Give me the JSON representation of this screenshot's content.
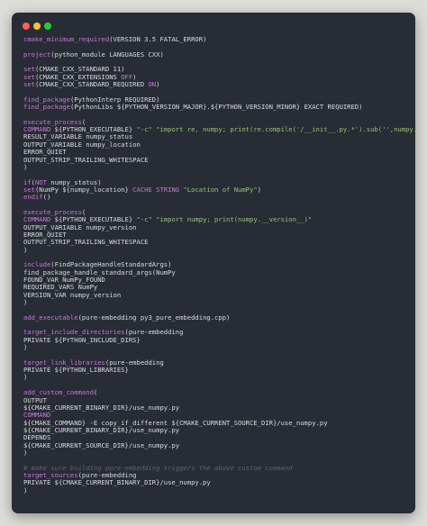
{
  "window": {
    "controls": [
      "close",
      "minimize",
      "maximize"
    ],
    "colors": {
      "close": "#ff5f56",
      "minimize": "#ffbd2e",
      "maximize": "#27c93f"
    }
  },
  "theme": {
    "background": "#282c34",
    "text": "#d8dbe0",
    "command": "#c678dd",
    "variable": "#e5c07b",
    "string": "#98c379",
    "comment": "#5c6370"
  },
  "code": {
    "lines": [
      [
        [
          "cmd",
          "cmake_minimum_required"
        ],
        [
          "t",
          "(VERSION 3.5 FATAL_ERROR)"
        ]
      ],
      [],
      [
        [
          "cmd",
          "project"
        ],
        [
          "t",
          "(python_module LANGUAGES CXX)"
        ]
      ],
      [],
      [
        [
          "cmd",
          "set"
        ],
        [
          "t",
          "(CMAKE_CXX_STANDARD 11)"
        ]
      ],
      [
        [
          "cmd",
          "set"
        ],
        [
          "t",
          "(CMAKE_CXX_EXTENSIONS "
        ],
        [
          "kw",
          "OFF"
        ],
        [
          "t",
          ")"
        ]
      ],
      [
        [
          "cmd",
          "set"
        ],
        [
          "t",
          "(CMAKE_CXX_STANDARD_REQUIRED "
        ],
        [
          "kw",
          "ON"
        ],
        [
          "t",
          ")"
        ]
      ],
      [],
      [
        [
          "cmd",
          "find_package"
        ],
        [
          "t",
          "(PythonInterp REQUIRED)"
        ]
      ],
      [
        [
          "cmd",
          "find_package"
        ],
        [
          "t",
          "(PythonLibs ${PYTHON_VERSION_MAJOR}.${PYTHON_VERSION_MINOR} EXACT REQUIRED)"
        ]
      ],
      [],
      [
        [
          "cmd",
          "execute_process"
        ],
        [
          "t",
          "("
        ]
      ],
      [
        [
          "kw",
          "COMMAND"
        ],
        [
          "t",
          " ${PYTHON_EXECUTABLE} "
        ],
        [
          "str",
          "\"-c\" \"import re, numpy; print(re.compile('/__init__.py.*').sub('',numpy.__file__))\""
        ]
      ],
      [
        [
          "t",
          "RESULT_VARIABLE numpy_status"
        ]
      ],
      [
        [
          "t",
          "OUTPUT_VARIABLE numpy_location"
        ]
      ],
      [
        [
          "t",
          "ERROR_QUIET"
        ]
      ],
      [
        [
          "t",
          "OUTPUT_STRIP_TRAILING_WHITESPACE"
        ]
      ],
      [
        [
          "t",
          ")"
        ]
      ],
      [],
      [
        [
          "cmd",
          "if"
        ],
        [
          "t",
          "("
        ],
        [
          "kw",
          "NOT"
        ],
        [
          "t",
          " numpy_status)"
        ]
      ],
      [
        [
          "cmd",
          "set"
        ],
        [
          "t",
          "(NumPy ${numpy_location} "
        ],
        [
          "kw",
          "CACHE STRING"
        ],
        [
          "t",
          " "
        ],
        [
          "str",
          "\"Location of NumPy\""
        ],
        [
          "t",
          ")"
        ]
      ],
      [
        [
          "cmd",
          "endif"
        ],
        [
          "t",
          "()"
        ]
      ],
      [],
      [
        [
          "cmd",
          "execute_process"
        ],
        [
          "t",
          "("
        ]
      ],
      [
        [
          "kw",
          "COMMAND"
        ],
        [
          "t",
          " ${PYTHON_EXECUTABLE} "
        ],
        [
          "str",
          "\"-c\" \"import numpy; print(numpy.__version__)\""
        ]
      ],
      [
        [
          "t",
          "OUTPUT_VARIABLE numpy_version"
        ]
      ],
      [
        [
          "t",
          "ERROR_QUIET"
        ]
      ],
      [
        [
          "t",
          "OUTPUT_STRIP_TRAILING_WHITESPACE"
        ]
      ],
      [
        [
          "t",
          ")"
        ]
      ],
      [],
      [
        [
          "cmd",
          "include"
        ],
        [
          "t",
          "(FindPackageHandleStandardArgs)"
        ]
      ],
      [
        [
          "t",
          "find_package_handle_standard_args(NumPy"
        ]
      ],
      [
        [
          "t",
          "FOUND_VAR NumPy_FOUND"
        ]
      ],
      [
        [
          "t",
          "REQUIRED_VARS NumPy"
        ]
      ],
      [
        [
          "t",
          "VERSION_VAR numpy_version"
        ]
      ],
      [
        [
          "t",
          ")"
        ]
      ],
      [],
      [
        [
          "cmd",
          "add_executable"
        ],
        [
          "t",
          "(pure-embedding py3_pure_embedding.cpp)"
        ]
      ],
      [],
      [
        [
          "cmd",
          "target_include_directories"
        ],
        [
          "t",
          "(pure-embedding"
        ]
      ],
      [
        [
          "t",
          "PRIVATE ${PYTHON_INCLUDE_DIRS}"
        ]
      ],
      [
        [
          "t",
          ")"
        ]
      ],
      [],
      [
        [
          "cmd",
          "target_link_libraries"
        ],
        [
          "t",
          "(pure-embedding"
        ]
      ],
      [
        [
          "t",
          "PRIVATE ${PYTHON_LIBRARIES}"
        ]
      ],
      [
        [
          "t",
          ")"
        ]
      ],
      [],
      [
        [
          "cmd",
          "add_custom_command"
        ],
        [
          "t",
          "("
        ]
      ],
      [
        [
          "t",
          "OUTPUT"
        ]
      ],
      [
        [
          "t",
          "${CMAKE_CURRENT_BINARY_DIR}/use_numpy.py"
        ]
      ],
      [
        [
          "kw",
          "COMMAND"
        ]
      ],
      [
        [
          "t",
          "${CMAKE_COMMAND} -E copy_if_different ${CMAKE_CURRENT_SOURCE_DIR}/use_numpy.py"
        ]
      ],
      [
        [
          "t",
          "${CMAKE_CURRENT_BINARY_DIR}/use_numpy.py"
        ]
      ],
      [
        [
          "t",
          "DEPENDS"
        ]
      ],
      [
        [
          "t",
          "${CMAKE_CURRENT_SOURCE_DIR}/use_numpy.py"
        ]
      ],
      [
        [
          "t",
          ")"
        ]
      ],
      [],
      [
        [
          "cm",
          "# make sure building pure-embedding triggers the above custom command"
        ]
      ],
      [
        [
          "cmd",
          "target_sources"
        ],
        [
          "t",
          "(pure-embedding"
        ]
      ],
      [
        [
          "t",
          "PRIVATE ${CMAKE_CURRENT_BINARY_DIR}/use_numpy.py"
        ]
      ],
      [
        [
          "t",
          ")"
        ]
      ]
    ]
  }
}
